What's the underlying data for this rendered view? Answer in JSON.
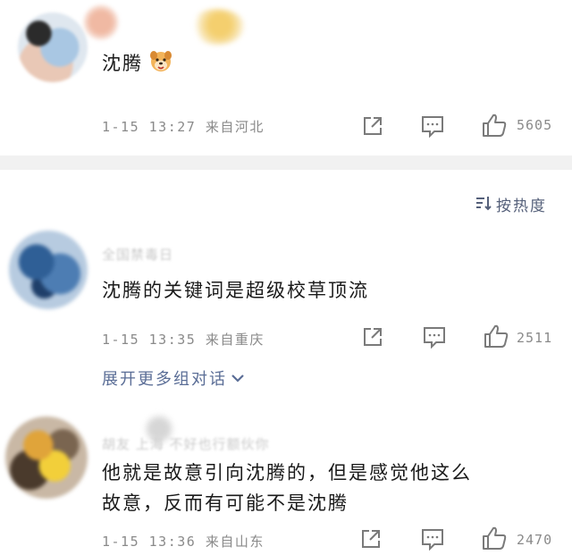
{
  "comments": [
    {
      "username": "",
      "text": "沈腾",
      "emoji_icon": "dog-face-emoji",
      "meta": "1-15 13:27 来自河北",
      "like_count": "5605"
    },
    {
      "username": "全国禁毒日",
      "text": "沈腾的关键词是超级校草顶流",
      "meta": "1-15 13:35 来自重庆",
      "like_count": "2511"
    },
    {
      "username": "胡友 上海 不好也行额伙你",
      "text_line1": "他就是故意引向沈腾的，但是感觉他这么",
      "text_line2": "故意，反而有可能不是沈腾",
      "meta": "1-15 13:36 来自山东",
      "like_count": "2470"
    }
  ],
  "sort": {
    "label": "按热度"
  },
  "expand": {
    "label": "展开更多组对话"
  },
  "icons": {
    "share": "share-icon",
    "comment": "comment-icon",
    "like": "thumbs-up-icon",
    "sort": "sort-icon",
    "chevron": "chevron-down-icon"
  },
  "colors": {
    "link": "#5a6d96",
    "meta": "#8a8a8a",
    "separator": "#f1f1f1"
  }
}
